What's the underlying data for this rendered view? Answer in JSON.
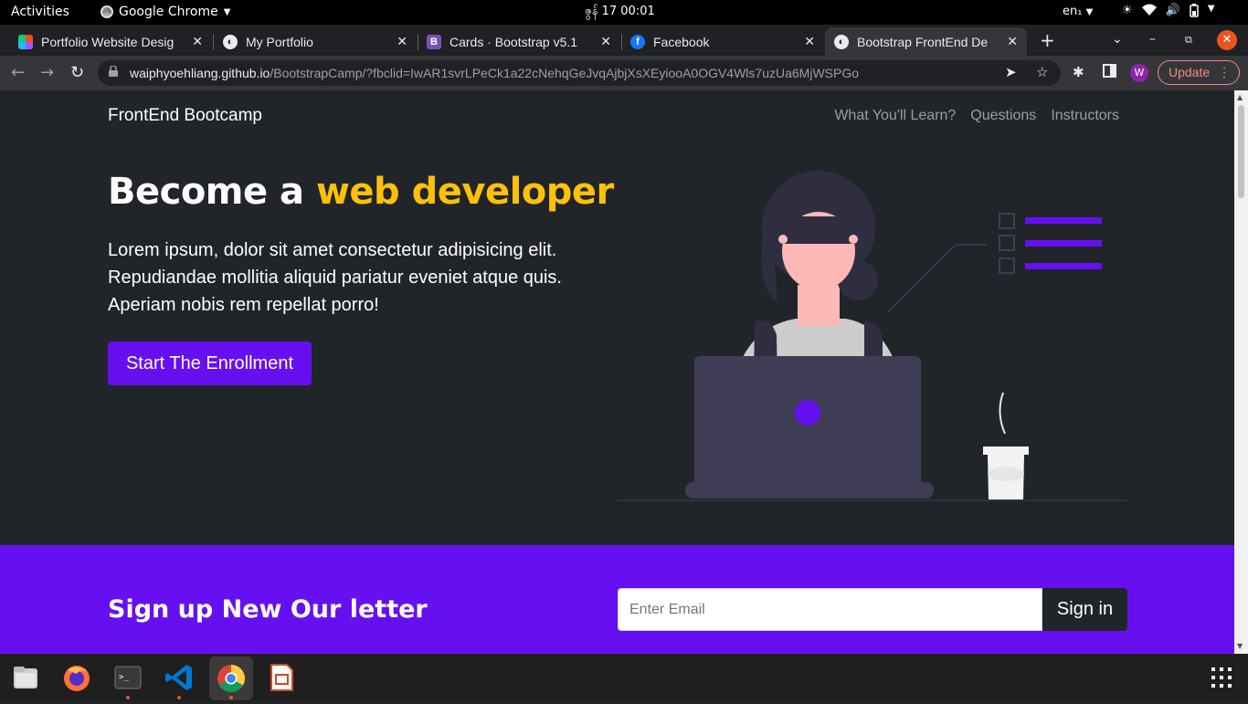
{
  "system": {
    "activities": "Activities",
    "app_name": "Google Chrome",
    "clock": "ဇွန် 17  00:01",
    "lang": "en₁"
  },
  "tabs": [
    {
      "label": "Portfolio Website Desig",
      "icon": "figma-icon"
    },
    {
      "label": "My Portfolio",
      "icon": "globe-icon"
    },
    {
      "label": "Cards · Bootstrap v5.1",
      "icon": "bootstrap-icon"
    },
    {
      "label": "Facebook",
      "icon": "facebook-icon"
    },
    {
      "label": "Bootstrap FrontEnd De",
      "icon": "globe-icon",
      "active": true
    }
  ],
  "toolbar": {
    "url_host": "waiphyoehliang.github.io",
    "url_path": "/BootstrapCamp/?fbclid=IwAR1svrLPeCk1a22cNehqGeJvqAjbjXsXEyiooA0OGV4Wls7uzUa6MjWSPGo",
    "profile_initial": "W",
    "update_label": "Update"
  },
  "page": {
    "brand": "FrontEnd Bootcamp",
    "nav": [
      "What You'll Learn?",
      "Questions",
      "Instructors"
    ],
    "hero_title_prefix": "Become a ",
    "hero_title_accent": "web developer",
    "lead": "Lorem ipsum, dolor sit amet consectetur adipisicing elit. Repudiandae mollitia aliquid pariatur eveniet atque quis. Aperiam nobis rem repellat porro!",
    "cta": "Start The Enrollment",
    "newsletter_title": "Sign up New Our letter",
    "newsletter_placeholder": "Enter Email",
    "newsletter_button": "Sign in"
  },
  "colors": {
    "accent_yellow": "#ffc107",
    "primary_purple": "#6610f2",
    "page_bg": "#212529"
  },
  "dock": [
    "files-icon",
    "firefox-icon",
    "terminal-icon",
    "vscode-icon",
    "chrome-icon",
    "impress-icon"
  ]
}
